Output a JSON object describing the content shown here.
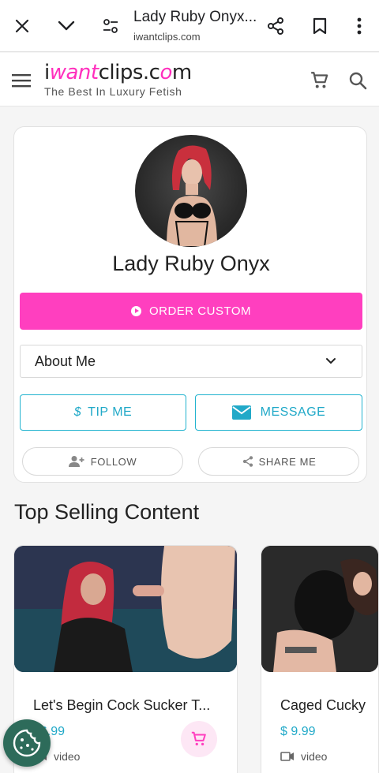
{
  "browser": {
    "title": "Lady Ruby Onyx...",
    "url": "iwantclips.com"
  },
  "site": {
    "logo_part1": "i",
    "logo_pink": "want",
    "logo_part2": "clips.c",
    "logo_pink2": "o",
    "logo_part3": "m",
    "tagline": "The Best In Luxury Fetish"
  },
  "profile": {
    "name": "Lady Ruby Onyx",
    "order_custom_label": "ORDER CUSTOM",
    "about_label": "About Me",
    "tip_label": "TIP ME",
    "tip_symbol": "$",
    "message_label": "MESSAGE",
    "follow_label": "FOLLOW",
    "share_label": "SHARE ME"
  },
  "section": {
    "heading": "Top Selling Content"
  },
  "clips": [
    {
      "title": "Let's Begin Cock Sucker T...",
      "price": "$6.99",
      "type": "video"
    },
    {
      "title": "Caged Cucky",
      "price": "$ 9.99",
      "type": "video"
    }
  ],
  "colors": {
    "accent_pink": "#ff3fbf",
    "accent_cyan": "#21a9c8"
  },
  "icons": {
    "close": "close-icon",
    "chevron": "chevron-down-icon",
    "tune": "site-settings-icon",
    "share": "share-icon",
    "bookmark": "bookmark-icon",
    "more": "more-vert-icon",
    "menu": "hamburger-icon",
    "cart": "cart-icon",
    "search": "search-icon",
    "cookie": "cookie-icon"
  }
}
